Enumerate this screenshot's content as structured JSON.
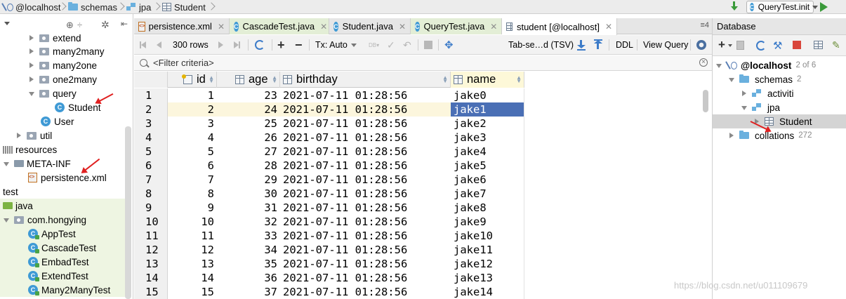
{
  "navbar": {
    "breadcrumbs": [
      "@localhost",
      "schemas",
      "jpa",
      "Student"
    ],
    "run_config": "QueryTest.init"
  },
  "left_tree": {
    "items": [
      {
        "label": "extend",
        "kind": "package",
        "arrow": "right"
      },
      {
        "label": "many2many",
        "kind": "package",
        "arrow": "right"
      },
      {
        "label": "many2one",
        "kind": "package",
        "arrow": "right"
      },
      {
        "label": "one2many",
        "kind": "package",
        "arrow": "right"
      },
      {
        "label": "query",
        "kind": "package",
        "arrow": "down"
      },
      {
        "label": "Student",
        "kind": "class"
      },
      {
        "label": "User",
        "kind": "class"
      },
      {
        "label": "util",
        "kind": "package",
        "arrow": "right"
      },
      {
        "label": "resources",
        "kind": "resources"
      },
      {
        "label": "META-INF",
        "kind": "folder",
        "arrow": "down"
      },
      {
        "label": "persistence.xml",
        "kind": "xml"
      },
      {
        "label": "test",
        "kind": "plain"
      },
      {
        "label": "java",
        "kind": "testfolder"
      },
      {
        "label": "com.hongying",
        "kind": "testpackage",
        "arrow": "down"
      },
      {
        "label": "AppTest",
        "kind": "testclass"
      },
      {
        "label": "CascadeTest",
        "kind": "testclass"
      },
      {
        "label": "EmbadTest",
        "kind": "testclass"
      },
      {
        "label": "ExtendTest",
        "kind": "testclass"
      },
      {
        "label": "Many2ManyTest",
        "kind": "testclass"
      }
    ]
  },
  "tabs": [
    {
      "label": "persistence.xml",
      "icon": "xml-icon"
    },
    {
      "label": "CascadeTest.java",
      "icon": "class-icon"
    },
    {
      "label": "Student.java",
      "icon": "class-icon"
    },
    {
      "label": "QueryTest.java",
      "icon": "class-icon"
    },
    {
      "label": "student [@localhost]",
      "icon": "table-icon"
    }
  ],
  "tab_overflow": "≡4",
  "grid_toolbar": {
    "rows_label": "300 rows",
    "tx_label": "Tx: Auto",
    "format_label": "Tab-se…d (TSV)",
    "ddl_label": "DDL",
    "view_query_label": "View Query"
  },
  "filter": {
    "placeholder": "<Filter criteria>"
  },
  "grid": {
    "columns": [
      "id",
      "age",
      "birthday",
      "name"
    ],
    "rows": [
      [
        "1",
        "1",
        "23",
        "2021-07-11 01:28:56",
        "jake0"
      ],
      [
        "2",
        "2",
        "24",
        "2021-07-11 01:28:56",
        "jake1"
      ],
      [
        "3",
        "3",
        "25",
        "2021-07-11 01:28:56",
        "jake2"
      ],
      [
        "4",
        "4",
        "26",
        "2021-07-11 01:28:56",
        "jake3"
      ],
      [
        "5",
        "5",
        "27",
        "2021-07-11 01:28:56",
        "jake4"
      ],
      [
        "6",
        "6",
        "28",
        "2021-07-11 01:28:56",
        "jake5"
      ],
      [
        "7",
        "7",
        "29",
        "2021-07-11 01:28:56",
        "jake6"
      ],
      [
        "8",
        "8",
        "30",
        "2021-07-11 01:28:56",
        "jake7"
      ],
      [
        "9",
        "9",
        "31",
        "2021-07-11 01:28:56",
        "jake8"
      ],
      [
        "10",
        "10",
        "32",
        "2021-07-11 01:28:56",
        "jake9"
      ],
      [
        "11",
        "11",
        "33",
        "2021-07-11 01:28:56",
        "jake10"
      ],
      [
        "12",
        "12",
        "34",
        "2021-07-11 01:28:56",
        "jake11"
      ],
      [
        "13",
        "13",
        "35",
        "2021-07-11 01:28:56",
        "jake12"
      ],
      [
        "14",
        "14",
        "36",
        "2021-07-11 01:28:56",
        "jake13"
      ],
      [
        "15",
        "15",
        "37",
        "2021-07-11 01:28:56",
        "jake14"
      ]
    ]
  },
  "db_pane": {
    "title": "Database",
    "tree": [
      {
        "label": "@localhost",
        "count": "2 of 6"
      },
      {
        "label": "schemas",
        "count": "2"
      },
      {
        "label": "activiti",
        "count": ""
      },
      {
        "label": "jpa",
        "count": ""
      },
      {
        "label": "Student",
        "count": ""
      },
      {
        "label": "collations",
        "count": "272"
      }
    ]
  },
  "watermark": "https://blog.csdn.net/u011109679",
  "colors": {
    "accent": "#3d7cc9",
    "selection": "#4a6fb5",
    "test_bg": "#eef5e2",
    "annotation": "#e02020"
  }
}
